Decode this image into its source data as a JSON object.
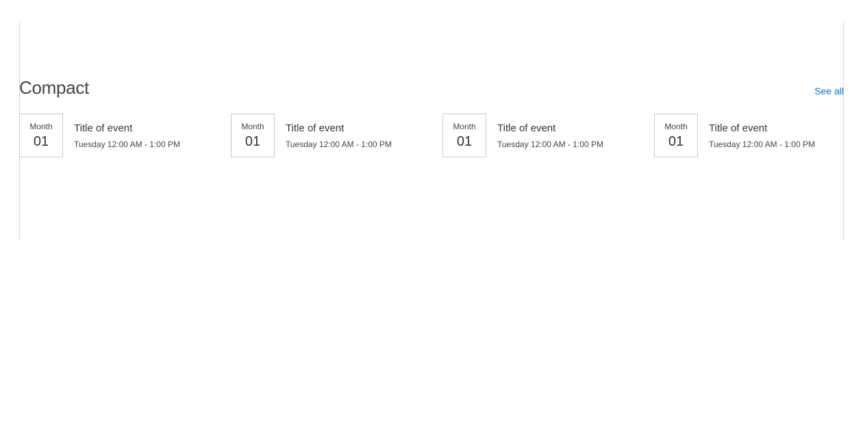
{
  "section": {
    "title": "Compact",
    "see_all_label": "See all"
  },
  "colors": {
    "accent": "#0078d4",
    "guide": "#e6cdf0",
    "border": "#c8c8c8"
  },
  "events": [
    {
      "month": "Month",
      "day": "01",
      "title": "Title of event",
      "time": "Tuesday 12:00 AM - 1:00 PM"
    },
    {
      "month": "Month",
      "day": "01",
      "title": "Title of event",
      "time": "Tuesday 12:00 AM - 1:00 PM"
    },
    {
      "month": "Month",
      "day": "01",
      "title": "Title of event",
      "time": "Tuesday 12:00 AM - 1:00 PM"
    },
    {
      "month": "Month",
      "day": "01",
      "title": "Title of event",
      "time": "Tuesday 12:00 AM - 1:00 PM"
    }
  ]
}
